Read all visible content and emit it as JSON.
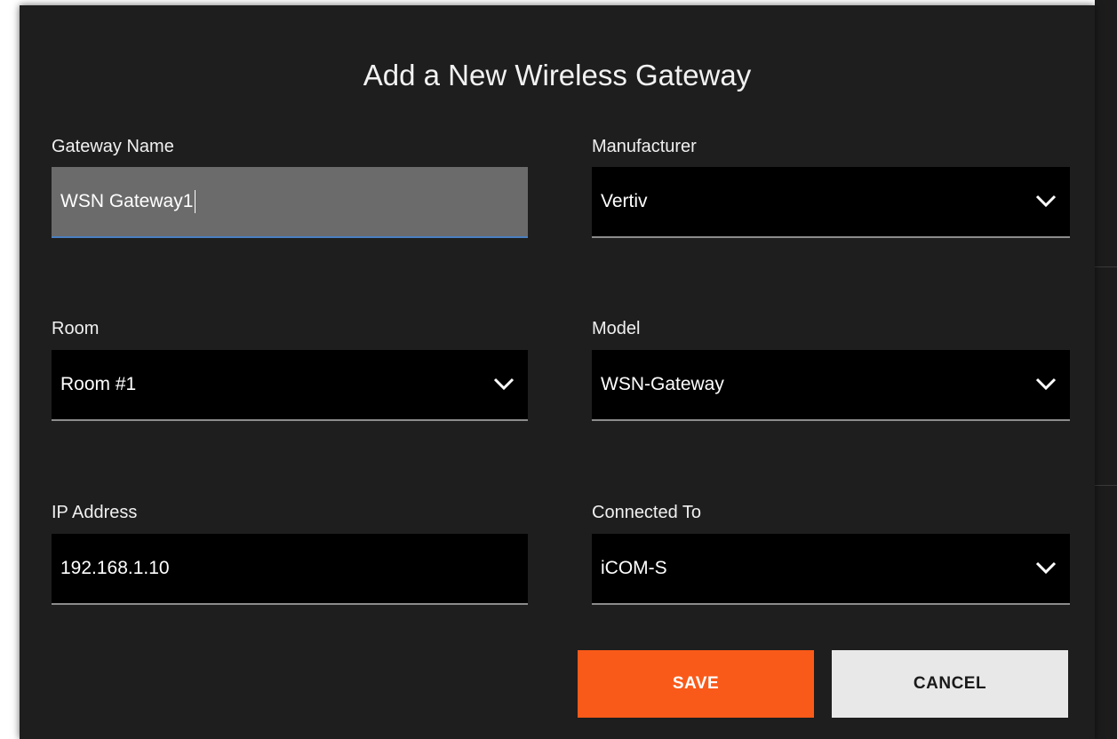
{
  "dialog": {
    "title": "Add a New Wireless Gateway"
  },
  "fields": {
    "gateway_name": {
      "label": "Gateway Name",
      "value": "WSN Gateway1"
    },
    "manufacturer": {
      "label": "Manufacturer",
      "value": "Vertiv"
    },
    "room": {
      "label": "Room",
      "value": "Room #1"
    },
    "model": {
      "label": "Model",
      "value": "WSN-Gateway"
    },
    "ip_address": {
      "label": "IP Address",
      "value": "192.168.1.10"
    },
    "connected_to": {
      "label": "Connected To",
      "value": "iCOM-S"
    }
  },
  "buttons": {
    "save": "SAVE",
    "cancel": "CANCEL"
  },
  "colors": {
    "accent": "#fa5a19",
    "focus_underline": "#4a7fc1",
    "dialog_bg": "#1e1e1e"
  },
  "icons": {
    "dropdown": "chevron-down-icon"
  }
}
